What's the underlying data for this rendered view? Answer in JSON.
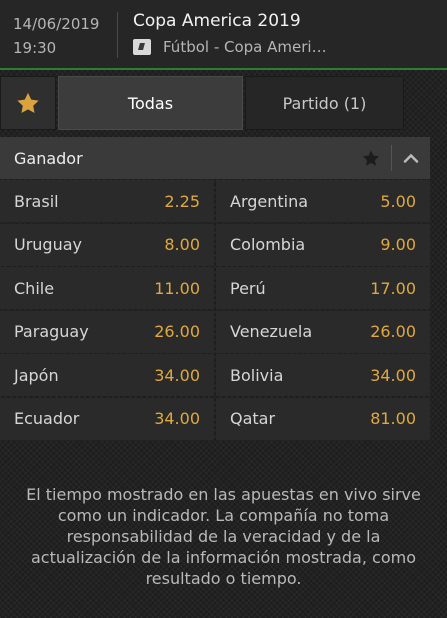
{
  "event": {
    "date": "14/06/2019",
    "time": "19:30",
    "title": "Copa America 2019",
    "league": "Fútbol - Copa Ameri…"
  },
  "tabs": [
    {
      "label": "Todas",
      "active": true
    },
    {
      "label": "Partido (1)",
      "active": false
    }
  ],
  "market": {
    "title": "Ganador",
    "selections": [
      [
        {
          "team": "Brasil",
          "odds": "2.25"
        },
        {
          "team": "Argentina",
          "odds": "5.00"
        }
      ],
      [
        {
          "team": "Uruguay",
          "odds": "8.00"
        },
        {
          "team": "Colombia",
          "odds": "9.00"
        }
      ],
      [
        {
          "team": "Chile",
          "odds": "11.00"
        },
        {
          "team": "Perú",
          "odds": "17.00"
        }
      ],
      [
        {
          "team": "Paraguay",
          "odds": "26.00"
        },
        {
          "team": "Venezuela",
          "odds": "26.00"
        }
      ],
      [
        {
          "team": "Japón",
          "odds": "34.00"
        },
        {
          "team": "Bolivia",
          "odds": "34.00"
        }
      ],
      [
        {
          "team": "Ecuador",
          "odds": "34.00"
        },
        {
          "team": "Qatar",
          "odds": "81.00"
        }
      ]
    ]
  },
  "disclaimer": "El tiempo mostrado en las apuestas en vivo sirve como un indicador. La compañía no toma responsabilidad de la veracidad y de la actualización de la información mostrada, como resultado o tiempo.",
  "icons": {
    "favorites": "star-icon",
    "market_favorite": "star-icon",
    "collapse": "chevron-up-icon",
    "sport": "football-icon"
  },
  "colors": {
    "odds": "#e0a93a",
    "favorite_star": "#d9a440",
    "accent_border": "#2e7d32"
  }
}
